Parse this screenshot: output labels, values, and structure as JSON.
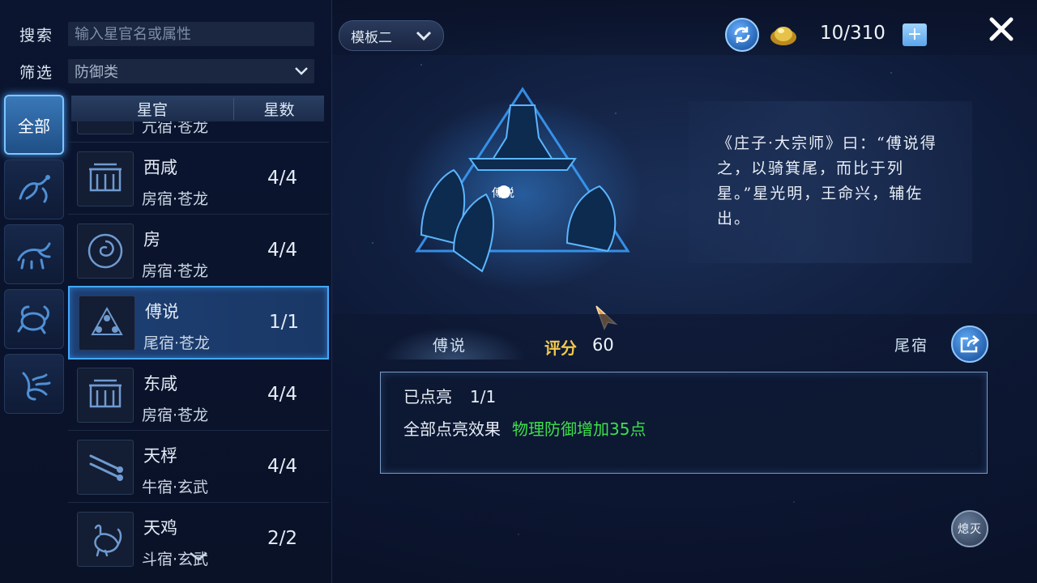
{
  "search": {
    "label": "搜索",
    "placeholder": "输入星官名或属性"
  },
  "filter": {
    "label": "筛选",
    "value": "防御类"
  },
  "categories": [
    {
      "label": "全部",
      "active": true
    },
    {
      "icon": "dragon-icon",
      "active": false
    },
    {
      "icon": "tiger-icon",
      "active": false
    },
    {
      "icon": "tortoise-icon",
      "active": false
    },
    {
      "icon": "phoenix-icon",
      "active": false
    }
  ],
  "list_header": {
    "name": "星官",
    "stars": "星数"
  },
  "star_list": [
    {
      "name": "",
      "sub": "亢宿·苍龙",
      "count": "",
      "partial": true
    },
    {
      "name": "西咸",
      "sub": "房宿·苍龙",
      "count": "4/4",
      "icon": "gate-icon"
    },
    {
      "name": "房",
      "sub": "房宿·苍龙",
      "count": "4/4",
      "icon": "swirl-icon"
    },
    {
      "name": "傅说",
      "sub": "尾宿·苍龙",
      "count": "1/1",
      "icon": "constellation-icon",
      "selected": true
    },
    {
      "name": "东咸",
      "sub": "房宿·苍龙",
      "count": "4/4",
      "icon": "gate-icon"
    },
    {
      "name": "天桴",
      "sub": "牛宿·玄武",
      "count": "4/4",
      "icon": "drumsticks-icon"
    },
    {
      "name": "天鸡",
      "sub": "斗宿·玄武",
      "count": "2/2",
      "icon": "rooster-icon"
    }
  ],
  "topbar": {
    "template": "模板二",
    "counter": "10/310",
    "plus": "+"
  },
  "hero": {
    "figure_label": "傅说",
    "quote": "《庄子·大宗师》曰：“傅说得之，以骑箕尾，而比于列星。”星光明，王命兴，辅佐出。"
  },
  "info": {
    "name": "傅说",
    "score_label": "评分",
    "score": "60",
    "house": "尾宿",
    "lit_label": "已点亮",
    "lit_value": "1/1",
    "effect_label": "全部点亮效果",
    "effect_value": "物理防御增加35点",
    "extinguish": "熄灭"
  },
  "colors": {
    "accent": "#41a8ff",
    "effect_green": "#3ce04a",
    "score_gold": "#f2c94c"
  }
}
